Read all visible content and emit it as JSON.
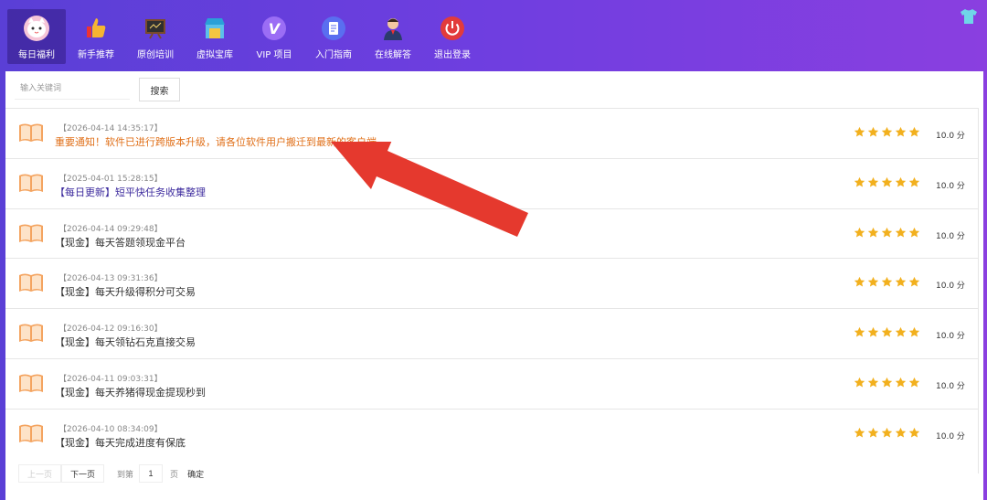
{
  "colors": {
    "accent_purple": "#6a3de0",
    "title_orange": "#e0701a",
    "title_purple": "#3d2b9e",
    "star": "#f2b01e",
    "arrow": "#e5392e"
  },
  "nav": [
    {
      "label": "每日福利",
      "icon": "cat-icon",
      "active": true
    },
    {
      "label": "新手推荐",
      "icon": "thumbs-up-icon"
    },
    {
      "label": "原创培训",
      "icon": "blackboard-icon"
    },
    {
      "label": "虚拟宝库",
      "icon": "store-icon"
    },
    {
      "label": "VIP 项目",
      "icon": "vip-icon"
    },
    {
      "label": "入门指南",
      "icon": "document-icon"
    },
    {
      "label": "在线解答",
      "icon": "support-agent-icon"
    },
    {
      "label": "退出登录",
      "icon": "power-icon"
    }
  ],
  "search": {
    "placeholder": "输入关键词",
    "button": "搜索"
  },
  "rows": [
    {
      "date": "【2026-04-14 14:35:17】",
      "title": "重要通知！软件已进行跨版本升级，请各位软件用户搬迁到最新的客户端",
      "style": "orange",
      "score": "10.0 分",
      "rating": 5
    },
    {
      "date": "【2025-04-01 15:28:15】",
      "title": "【每日更新】短平快任务收集整理",
      "style": "purple",
      "score": "10.0 分",
      "rating": 5
    },
    {
      "date": "【2026-04-14 09:29:48】",
      "title": "【现金】每天答题领现金平台",
      "style": "normal",
      "score": "10.0 分",
      "rating": 5
    },
    {
      "date": "【2026-04-13 09:31:36】",
      "title": "【现金】每天升级得积分可交易",
      "style": "normal",
      "score": "10.0 分",
      "rating": 5
    },
    {
      "date": "【2026-04-12 09:16:30】",
      "title": "【现金】每天领钻石克直接交易",
      "style": "normal",
      "score": "10.0 分",
      "rating": 5
    },
    {
      "date": "【2026-04-11 09:03:31】",
      "title": "【现金】每天养猪得现金提现秒到",
      "style": "normal",
      "score": "10.0 分",
      "rating": 5
    },
    {
      "date": "【2026-04-10 08:34:09】",
      "title": "【现金】每天完成进度有保底",
      "style": "normal",
      "score": "10.0 分",
      "rating": 5
    }
  ],
  "pager": {
    "prev": "上一页",
    "next": "下一页",
    "goto_prefix": "到第",
    "page_value": "1",
    "goto_suffix": "页",
    "confirm": "确定"
  }
}
